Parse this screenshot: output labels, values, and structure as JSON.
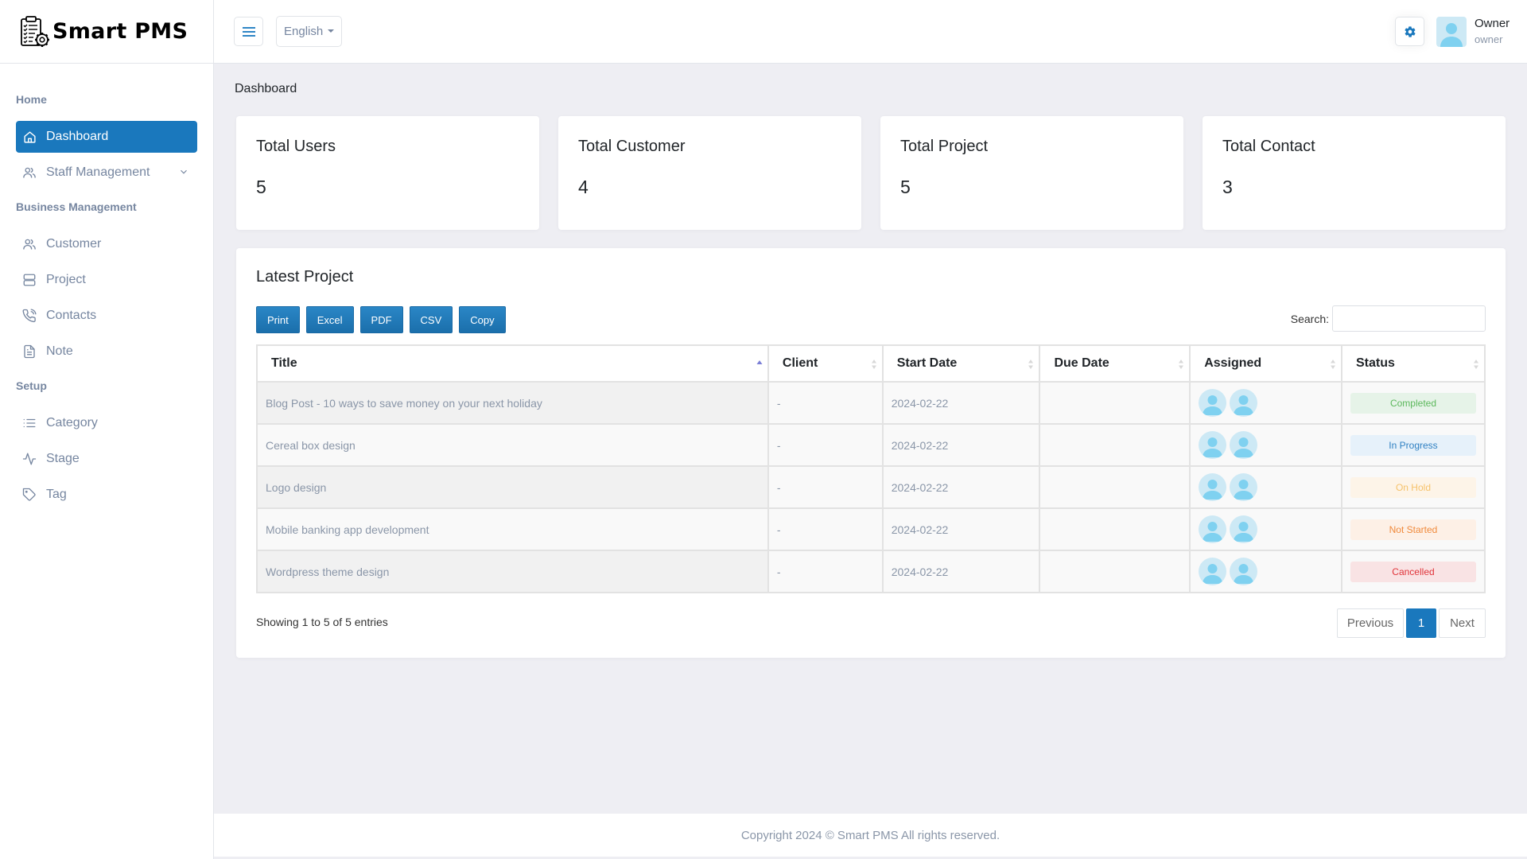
{
  "brand": {
    "name": "Smart PMS"
  },
  "sidebar": {
    "sections": [
      {
        "label": "Home"
      },
      {
        "label": "Business Management"
      },
      {
        "label": "Setup"
      }
    ],
    "items": [
      {
        "label": "Dashboard",
        "icon": "home-icon",
        "active": true
      },
      {
        "label": "Staff Management",
        "icon": "users-icon",
        "has_submenu": true
      },
      {
        "label": "Customer",
        "icon": "users-icon"
      },
      {
        "label": "Project",
        "icon": "server-icon"
      },
      {
        "label": "Contacts",
        "icon": "phone-call-icon"
      },
      {
        "label": "Note",
        "icon": "file-text-icon"
      },
      {
        "label": "Category",
        "icon": "list-icon"
      },
      {
        "label": "Stage",
        "icon": "activity-icon"
      },
      {
        "label": "Tag",
        "icon": "tag-icon"
      }
    ]
  },
  "header": {
    "language": "English",
    "user": {
      "name": "Owner",
      "role": "owner"
    }
  },
  "page": {
    "title": "Dashboard"
  },
  "stats": [
    {
      "label": "Total Users",
      "value": "5"
    },
    {
      "label": "Total Customer",
      "value": "4"
    },
    {
      "label": "Total Project",
      "value": "5"
    },
    {
      "label": "Total Contact",
      "value": "3"
    }
  ],
  "latest_project": {
    "title": "Latest Project",
    "export_buttons": [
      "Print",
      "Excel",
      "PDF",
      "CSV",
      "Copy"
    ],
    "search_label": "Search:",
    "search_value": "",
    "columns": [
      "Title",
      "Client",
      "Start Date",
      "Due Date",
      "Assigned",
      "Status"
    ],
    "sort": {
      "column": "Title",
      "direction": "asc"
    },
    "rows": [
      {
        "title": "Blog Post - 10 ways to save money on your next holiday",
        "client": "-",
        "start_date": "2024-02-22",
        "due_date": "",
        "assigned_count": 2,
        "status": "Completed"
      },
      {
        "title": "Cereal box design",
        "client": "-",
        "start_date": "2024-02-22",
        "due_date": "",
        "assigned_count": 2,
        "status": "In Progress"
      },
      {
        "title": "Logo design",
        "client": "-",
        "start_date": "2024-02-22",
        "due_date": "",
        "assigned_count": 2,
        "status": "On Hold"
      },
      {
        "title": "Mobile banking app development",
        "client": "-",
        "start_date": "2024-02-22",
        "due_date": "",
        "assigned_count": 2,
        "status": "Not Started"
      },
      {
        "title": "Wordpress theme design",
        "client": "-",
        "start_date": "2024-02-22",
        "due_date": "",
        "assigned_count": 2,
        "status": "Cancelled"
      }
    ],
    "status_colors": {
      "Completed": {
        "fg": "#5cb85c",
        "bg": "#e6f3e8"
      },
      "In Progress": {
        "fg": "#2f80c2",
        "bg": "#e6f1fa"
      },
      "On Hold": {
        "fg": "#f6c26b",
        "bg": "#fdf4e8"
      },
      "Not Started": {
        "fg": "#f08a3c",
        "bg": "#fdf0e6"
      },
      "Cancelled": {
        "fg": "#e0343a",
        "bg": "#f9e3e4"
      }
    },
    "info": "Showing 1 to 5 of 5 entries",
    "pagination": {
      "previous": "Previous",
      "current": "1",
      "next": "Next"
    }
  },
  "footer": {
    "text": "Copyright 2024 © Smart PMS All rights reserved."
  },
  "colors": {
    "accent": "#1a78bd",
    "muted": "#7686a0"
  }
}
